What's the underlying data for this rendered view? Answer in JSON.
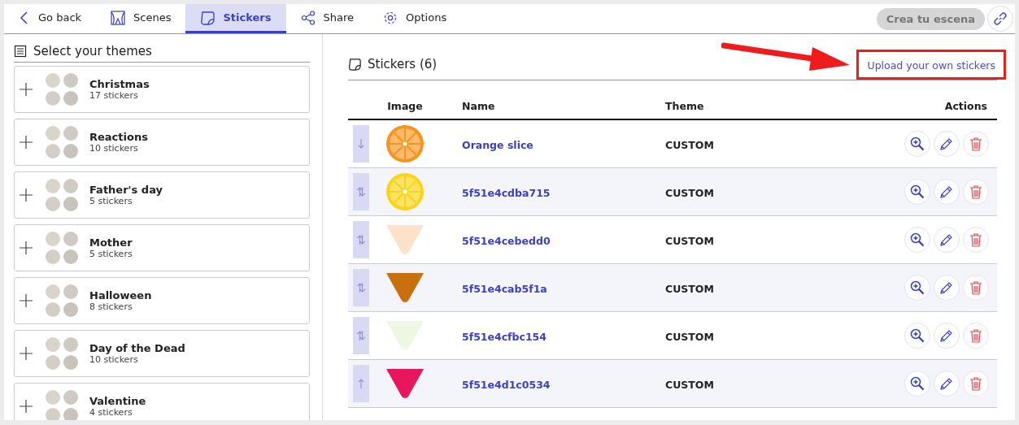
{
  "toolbar": {
    "back": "Go back",
    "tabs": [
      {
        "label": "Scenes",
        "selected": false
      },
      {
        "label": "Stickers",
        "selected": true
      },
      {
        "label": "Share",
        "selected": false
      },
      {
        "label": "Options",
        "selected": false
      }
    ],
    "create_button": {
      "label": "Crea tu escena",
      "disabled": true
    }
  },
  "themes": {
    "title": "Select your themes",
    "items": [
      {
        "name": "Christmas",
        "count": "17 stickers"
      },
      {
        "name": "Reactions",
        "count": "10 stickers"
      },
      {
        "name": "Father's day",
        "count": "5 stickers"
      },
      {
        "name": "Mother",
        "count": "5 stickers"
      },
      {
        "name": "Halloween",
        "count": "8 stickers"
      },
      {
        "name": "Day of the Dead",
        "count": "10 stickers"
      },
      {
        "name": "Valentine",
        "count": "4 stickers"
      }
    ]
  },
  "stickers": {
    "title": "Stickers (6)",
    "upload_link": "Upload your own stickers",
    "columns": [
      "Image",
      "Name",
      "Theme",
      "Actions"
    ],
    "rows": [
      {
        "kind": "slice",
        "color": "#f7941d",
        "name": "Orange slice",
        "theme": "CUSTOM"
      },
      {
        "kind": "slice",
        "color": "#fbd416",
        "name": "5f51e4cdba715",
        "theme": "CUSTOM"
      },
      {
        "kind": "cone",
        "color": "#fde1c8",
        "name": "5f51e4cebedd0",
        "theme": "CUSTOM"
      },
      {
        "kind": "cone",
        "color": "#c8700e",
        "name": "5f51e4cab5f1a",
        "theme": "CUSTOM"
      },
      {
        "kind": "cone",
        "color": "#eef6e4",
        "name": "5f51e4cfbc154",
        "theme": "CUSTOM"
      },
      {
        "kind": "cone",
        "color": "#e8175d",
        "name": "5f51e4d1c0534",
        "theme": "CUSTOM"
      }
    ]
  }
}
